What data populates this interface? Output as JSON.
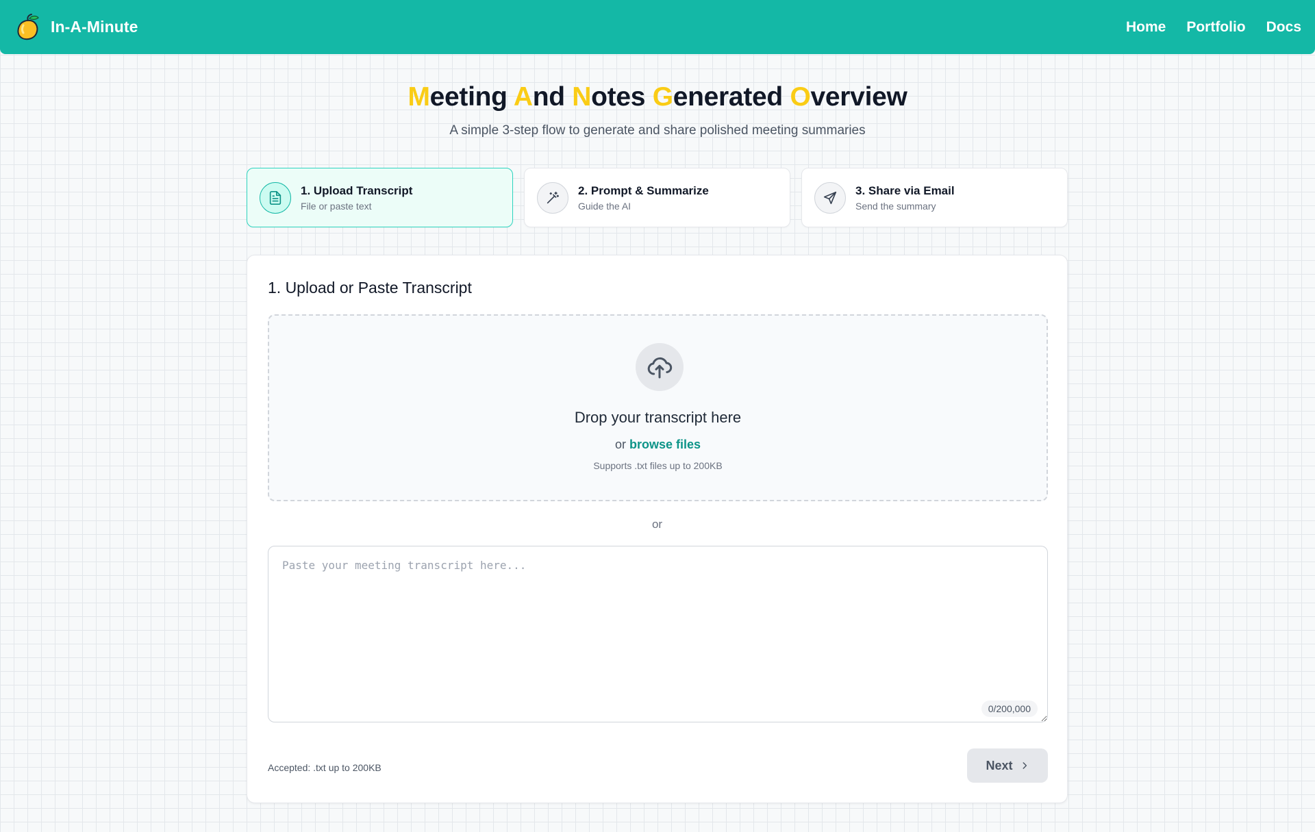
{
  "navbar": {
    "brand": "In-A-Minute",
    "links": [
      "Home",
      "Portfolio",
      "Docs"
    ]
  },
  "hero": {
    "title_parts": [
      {
        "initial": "M",
        "rest": "eeting"
      },
      {
        "initial": "A",
        "rest": "nd"
      },
      {
        "initial": "N",
        "rest": "otes"
      },
      {
        "initial": "G",
        "rest": "enerated"
      },
      {
        "initial": "O",
        "rest": "verview"
      }
    ],
    "subtitle": "A simple 3-step flow to generate and share polished meeting summaries"
  },
  "steps": [
    {
      "title": "1. Upload Transcript",
      "subtitle": "File or paste text",
      "icon": "file-text-icon",
      "active": true
    },
    {
      "title": "2. Prompt & Summarize",
      "subtitle": "Guide the AI",
      "icon": "magic-wand-icon",
      "active": false
    },
    {
      "title": "3. Share via Email",
      "subtitle": "Send the summary",
      "icon": "send-icon",
      "active": false
    }
  ],
  "card": {
    "title": "1. Upload or Paste Transcript",
    "dropzone": {
      "icon": "cloud-upload-icon",
      "title": "Drop your transcript here",
      "or_prefix": "or",
      "browse_label": "browse files",
      "note": "Supports .txt files up to 200KB"
    },
    "divider": "or",
    "textarea": {
      "placeholder": "Paste your meeting transcript here...",
      "value": "",
      "char_count": "0/200,000"
    },
    "accepted_note": "Accepted: .txt up to 200KB",
    "next_label": "Next"
  },
  "colors": {
    "brand": "#14b8a6",
    "highlight": "#facc15",
    "link": "#0d9488"
  }
}
